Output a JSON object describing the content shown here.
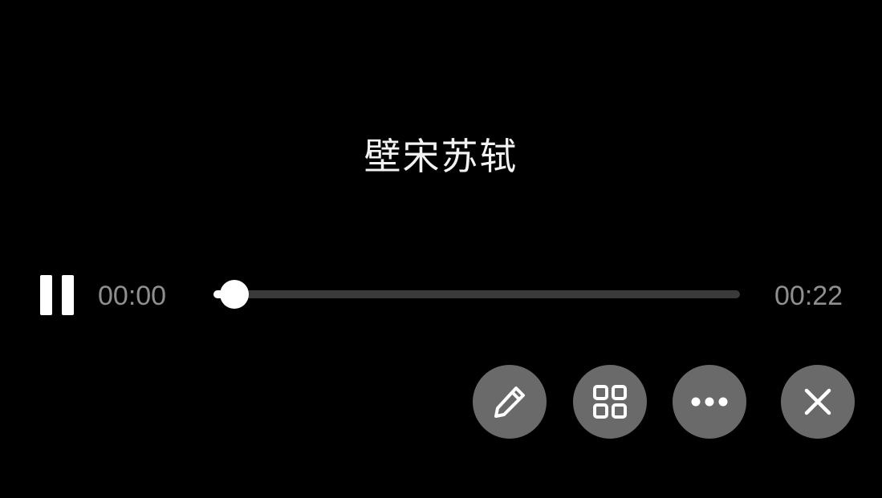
{
  "player": {
    "title": "壁宋苏轼",
    "current_time": "00:00",
    "total_time": "00:22",
    "progress": 0.04,
    "colors": {
      "background": "#000000",
      "button_fill": "#6a6a6a",
      "track": "#3a3a3a",
      "accent": "#ffffff",
      "time_text": "#8f8f8f"
    }
  },
  "icons": {
    "pause": "pause-icon",
    "edit": "pencil-icon",
    "grid": "grid-icon",
    "more": "more-icon",
    "close": "close-icon"
  }
}
